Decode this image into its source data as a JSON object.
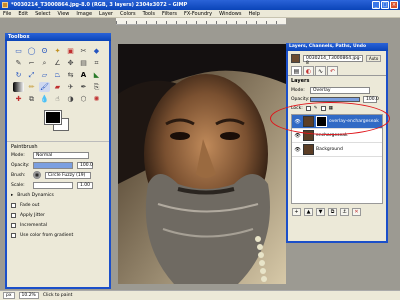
{
  "window": {
    "title": "*0030214_T3000864.jpg-8.0 (RGB, 3 layers) 2304x3072 – GIMP",
    "minimize": "_",
    "maximize": "□",
    "close": "×"
  },
  "menubar": {
    "items": [
      "File",
      "Edit",
      "Select",
      "View",
      "Image",
      "Layer",
      "Colors",
      "Tools",
      "Filters",
      "FX-Foundry",
      "Windows",
      "Help"
    ]
  },
  "toolbox": {
    "title": "Toolbox",
    "tool_icons": [
      "rect-select-icon",
      "ellipse-select-icon",
      "free-select-icon",
      "fuzzy-select-icon",
      "color-select-icon",
      "scissors-icon",
      "foreground-select-icon",
      "paths-icon",
      "color-picker-icon",
      "zoom-icon",
      "measure-icon",
      "move-icon",
      "align-icon",
      "crop-icon",
      "rotate-icon",
      "scale-icon",
      "shear-icon",
      "perspective-icon",
      "flip-icon",
      "text-icon",
      "bucket-fill-icon",
      "blend-icon",
      "pencil-icon",
      "paintbrush-icon",
      "eraser-icon",
      "airbrush-icon",
      "ink-icon",
      "clone-icon",
      "heal-icon",
      "perspective-clone-icon",
      "blur-icon",
      "smudge-icon",
      "dodge-icon",
      "cage-icon",
      "fx-icon"
    ],
    "paintbrush_header": "Paintbrush",
    "mode_label": "Mode:",
    "mode_value": "Normal",
    "opacity_label": "Opacity:",
    "opacity_value": "100.0",
    "brush_label": "Brush:",
    "brush_value": "Circle Fuzzy (19)",
    "scale_label": "Scale:",
    "scale_value": "1.00",
    "options": [
      "Brush Dynamics",
      "Fade out",
      "Apply Jitter",
      "Incremental",
      "Use color from gradient"
    ]
  },
  "layers": {
    "title": "Layers, Channels, Paths, Undo",
    "image_name": "0030214_T3000864.jpg-8",
    "header": "Layers",
    "mode_label": "Mode:",
    "mode_value": "Overlay",
    "opacity_label": "Opacity:",
    "opacity_value": "100.0",
    "lock_label": "Lock:",
    "items": [
      {
        "name": "overlay-enchargeseak",
        "selected": true,
        "has_mask": true
      },
      {
        "name": "enchargeseak",
        "selected": false,
        "has_mask": false
      },
      {
        "name": "Background",
        "selected": false,
        "has_mask": false
      }
    ]
  },
  "status": {
    "unit": "px",
    "zoom": "10.2%",
    "message": "Click to paint"
  },
  "colors": {
    "accent": "#1b4fc9",
    "highlight_ring": "#e0141a",
    "selected_row": "#316ac5"
  }
}
